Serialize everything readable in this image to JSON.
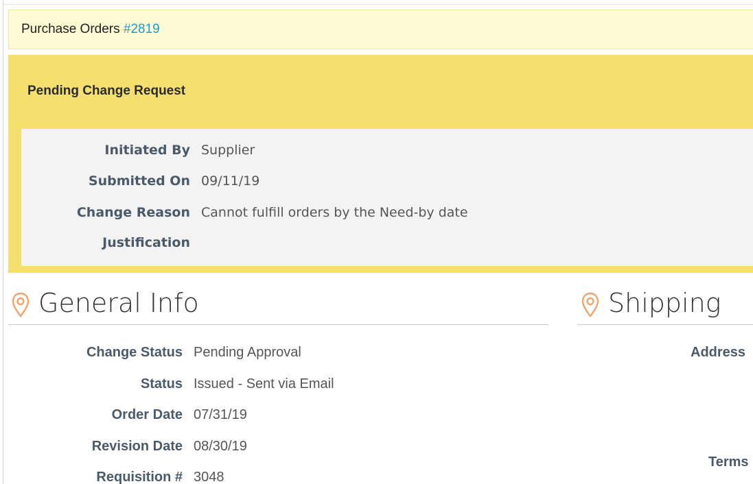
{
  "breadcrumb": {
    "section": "Purchase Orders",
    "po_number": "#2819"
  },
  "pending_change": {
    "title": "Pending Change Request",
    "fields": [
      {
        "label": "Initiated By",
        "value": "Supplier"
      },
      {
        "label": "Submitted On",
        "value": "09/11/19"
      },
      {
        "label": "Change Reason",
        "value": "Cannot fulfill orders by the Need-by date"
      },
      {
        "label": "Justification",
        "value": ""
      }
    ]
  },
  "general_info": {
    "title": "General Info",
    "icon": "map-pin-icon",
    "fields": [
      {
        "label": "Change Status",
        "value": "Pending Approval"
      },
      {
        "label": "Status",
        "value": "Issued - Sent via Email"
      },
      {
        "label": "Order Date",
        "value": "07/31/19"
      },
      {
        "label": "Revision Date",
        "value": "08/30/19"
      },
      {
        "label": "Requisition #",
        "value": "3048"
      }
    ]
  },
  "shipping": {
    "title": "Shipping",
    "icon": "map-pin-icon",
    "address_label": "Address",
    "terms_label": "Terms"
  },
  "colors": {
    "link": "#1a9bd7",
    "pending_bg": "#f5df6e",
    "breadcrumb_bg": "#fdfbd3",
    "pin": "#f0a36a"
  }
}
